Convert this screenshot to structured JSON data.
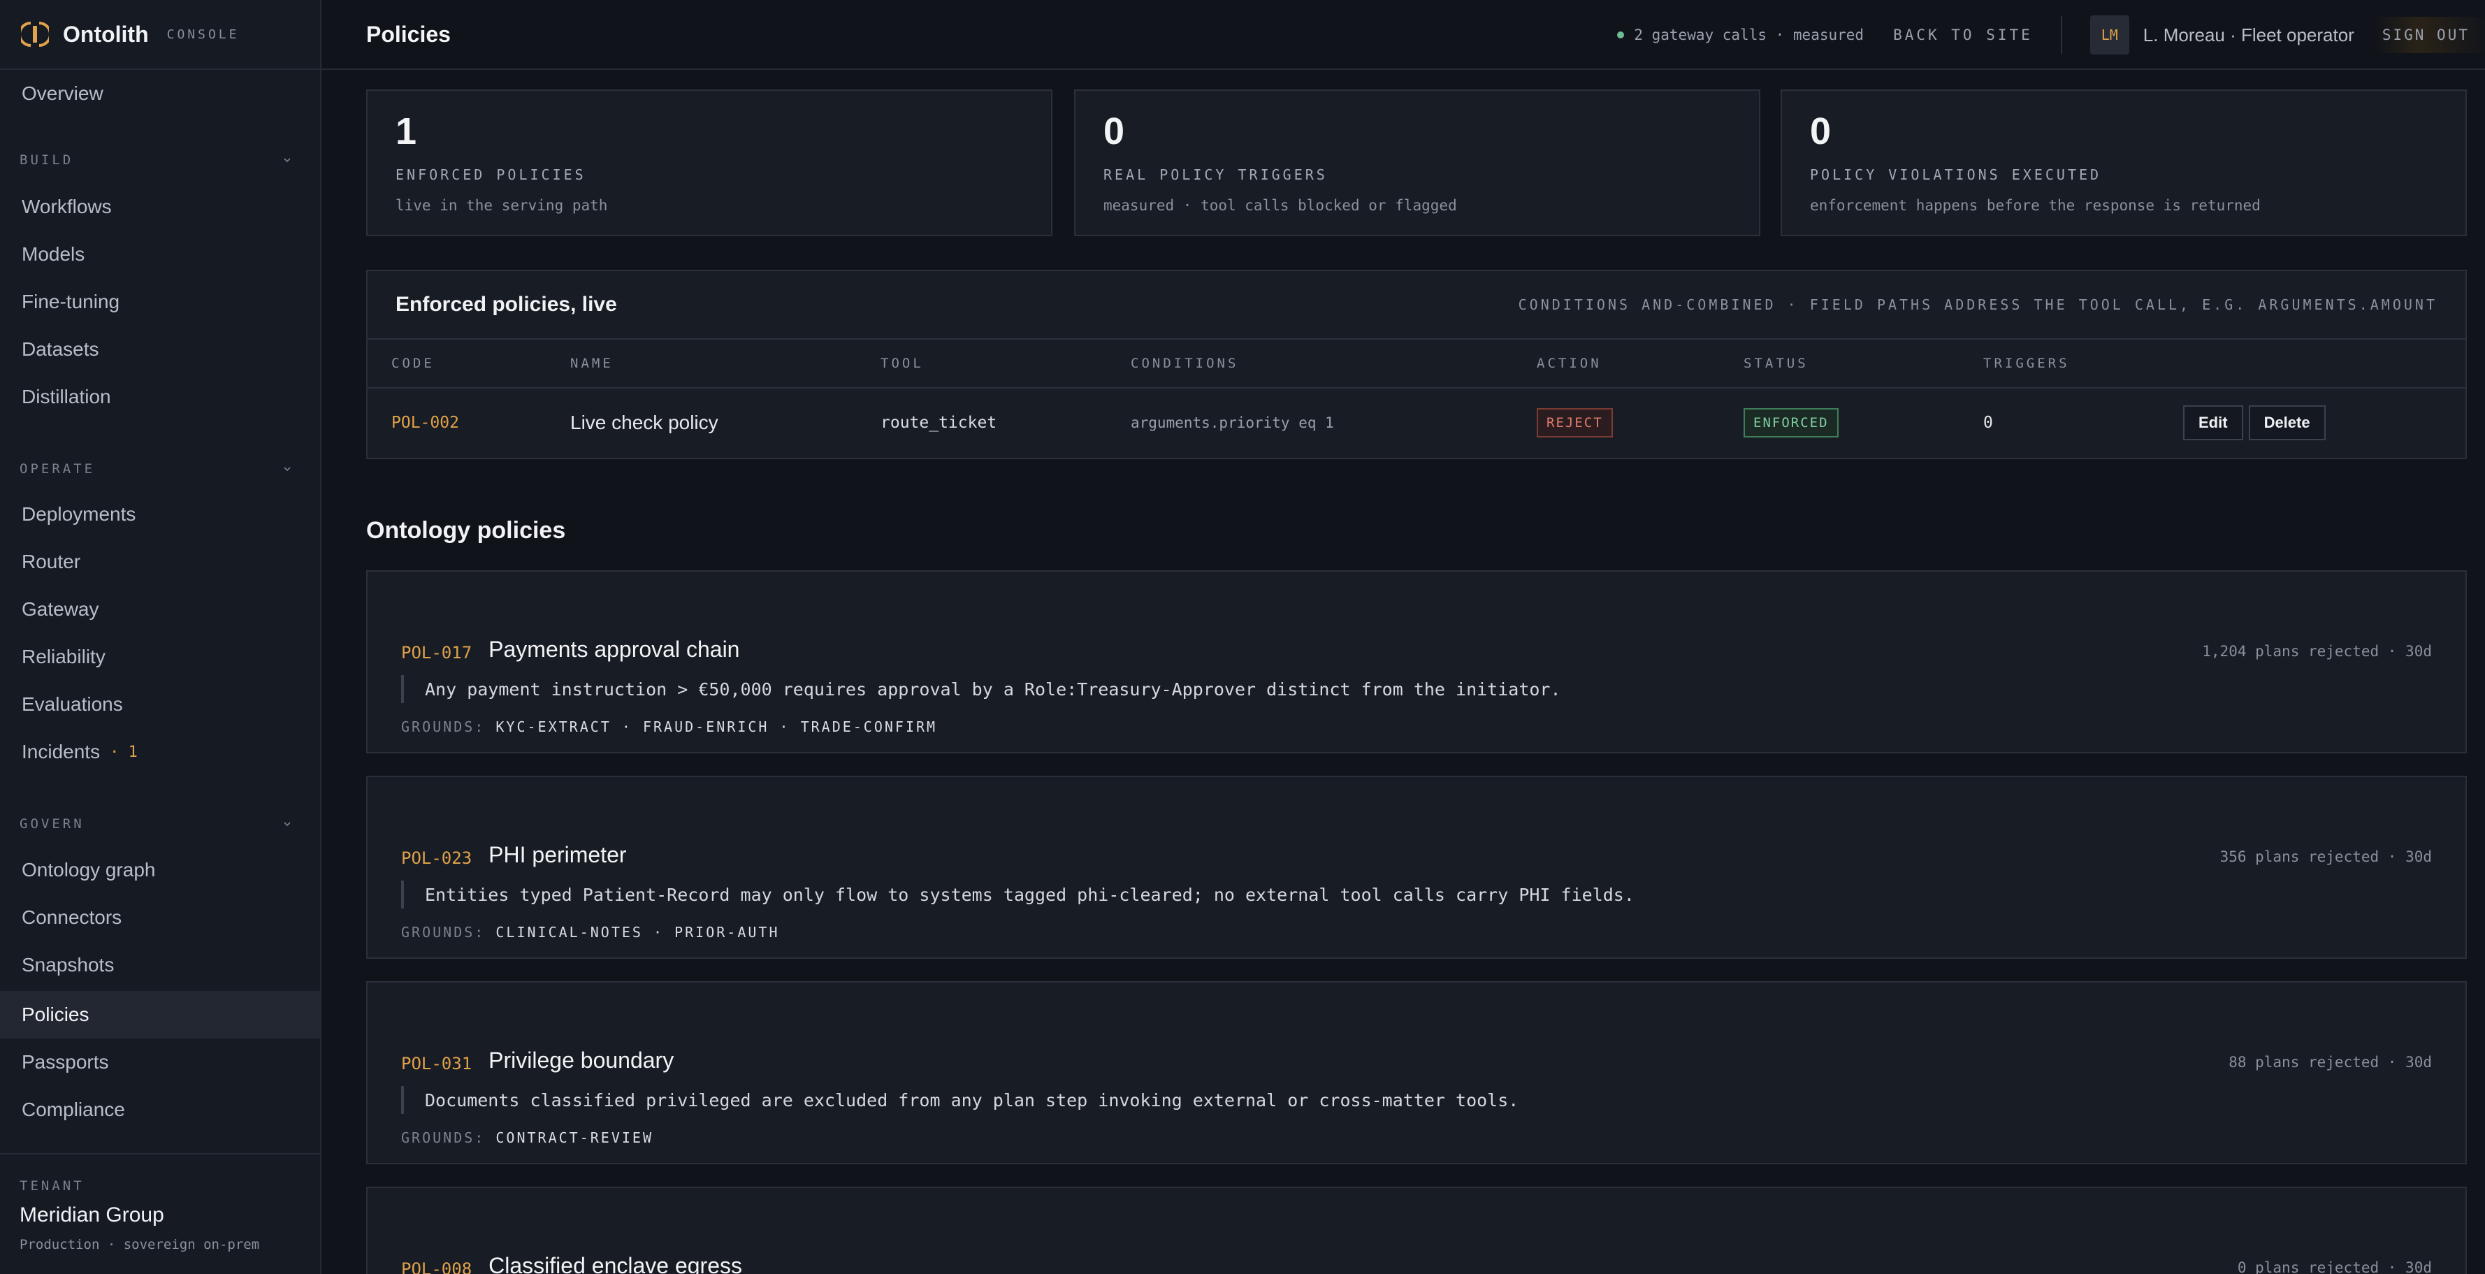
{
  "brand": {
    "name": "Ontolith",
    "sub": "CONSOLE"
  },
  "sidebar": {
    "overview": "Overview",
    "sections": [
      {
        "label": "BUILD",
        "items": [
          "Workflows",
          "Models",
          "Fine-tuning",
          "Datasets",
          "Distillation"
        ]
      },
      {
        "label": "OPERATE",
        "items": [
          "Deployments",
          "Router",
          "Gateway",
          "Reliability",
          "Evaluations",
          "Incidents"
        ]
      },
      {
        "label": "GOVERN",
        "items": [
          "Ontology graph",
          "Connectors",
          "Snapshots",
          "Policies",
          "Passports",
          "Compliance"
        ]
      }
    ],
    "incidents_count": "· 1",
    "active": "Policies",
    "tenant": {
      "label": "TENANT",
      "name": "Meridian Group",
      "meta": "Production · sovereign on-prem"
    }
  },
  "topbar": {
    "title": "Policies",
    "gateway_status": "2 gateway calls · measured",
    "back_link": "BACK TO SITE",
    "avatar_initials": "LM",
    "user": "L. Moreau · Fleet operator",
    "signout": "SIGN OUT"
  },
  "stats": [
    {
      "value": "1",
      "label": "ENFORCED POLICIES",
      "sub": "live in the serving path"
    },
    {
      "value": "0",
      "label": "REAL POLICY TRIGGERS",
      "sub": "measured · tool calls blocked or flagged"
    },
    {
      "value": "0",
      "label": "POLICY VIOLATIONS EXECUTED",
      "sub": "enforcement happens before the response is returned"
    }
  ],
  "enforced_table": {
    "title": "Enforced policies, live",
    "note": "CONDITIONS AND-COMBINED · FIELD PATHS ADDRESS THE TOOL CALL, E.G. ARGUMENTS.AMOUNT",
    "columns": [
      "CODE",
      "NAME",
      "TOOL",
      "CONDITIONS",
      "ACTION",
      "STATUS",
      "TRIGGERS"
    ],
    "rows": [
      {
        "code": "POL-002",
        "name": "Live check policy",
        "tool": "route_ticket",
        "conditions": "arguments.priority eq 1",
        "action": "REJECT",
        "status": "ENFORCED",
        "triggers": "0",
        "edit_label": "Edit",
        "delete_label": "Delete"
      }
    ]
  },
  "ontology": {
    "title": "Ontology policies",
    "grounds_label": "GROUNDS:",
    "policies": [
      {
        "code": "POL-017",
        "title": "Payments approval chain",
        "stat": "1,204 plans rejected · 30d",
        "rule": "Any payment instruction > €50,000 requires approval by a Role:Treasury-Approver distinct from the initiator.",
        "grounds": "KYC-EXTRACT · FRAUD-ENRICH · TRADE-CONFIRM"
      },
      {
        "code": "POL-023",
        "title": "PHI perimeter",
        "stat": "356 plans rejected · 30d",
        "rule": "Entities typed Patient-Record may only flow to systems tagged phi-cleared; no external tool calls carry PHI fields.",
        "grounds": "CLINICAL-NOTES · PRIOR-AUTH"
      },
      {
        "code": "POL-031",
        "title": "Privilege boundary",
        "stat": "88 plans rejected · 30d",
        "rule": "Documents classified privileged are excluded from any plan step invoking external or cross-matter tools.",
        "grounds": "CONTRACT-REVIEW"
      },
      {
        "code": "POL-008",
        "title": "Classified enclave egress",
        "stat": "0 plans rejected · 30d",
        "rule": "",
        "grounds": ""
      }
    ]
  },
  "colors": {
    "accent": "#e0a24a",
    "reject": "#e07b6e",
    "enforced": "#7fcfa1",
    "status_dot": "#6dbd93"
  }
}
